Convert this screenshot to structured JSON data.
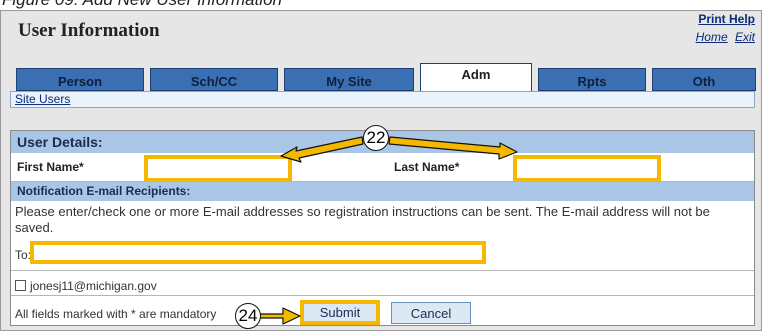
{
  "figure_caption": "Figure 09: Add New User Information",
  "header": {
    "title": "User Information",
    "print_help": "Print Help",
    "home": "Home",
    "exit": "Exit"
  },
  "tabs": [
    {
      "label": "Person"
    },
    {
      "label": "Sch/CC"
    },
    {
      "label": "My Site"
    },
    {
      "label": "Adm",
      "active": true
    },
    {
      "label": "Rpts"
    },
    {
      "label": "Oth"
    }
  ],
  "subnav": {
    "site_users": "Site Users"
  },
  "user_details": {
    "header": "User Details:",
    "first_name_label": "First Name*",
    "first_name_value": "",
    "last_name_label": "Last Name*",
    "last_name_value": ""
  },
  "notification": {
    "header": "Notification E-mail Recipients:",
    "instructions": "Please enter/check one or more E-mail addresses so registration instructions can be sent. The E-mail address will not be saved.",
    "to_label": "To:",
    "to_value": "",
    "recipient_email": "jonesj11@michigan.gov"
  },
  "footer": {
    "mandatory_note": "All fields marked with * are mandatory",
    "submit_label": "Submit",
    "cancel_label": "Cancel"
  },
  "callouts": {
    "one": "22",
    "two": "24"
  },
  "colors": {
    "highlight": "#f5b800",
    "tab_blue": "#3a6fb4",
    "section_header": "#a9c6e7"
  }
}
